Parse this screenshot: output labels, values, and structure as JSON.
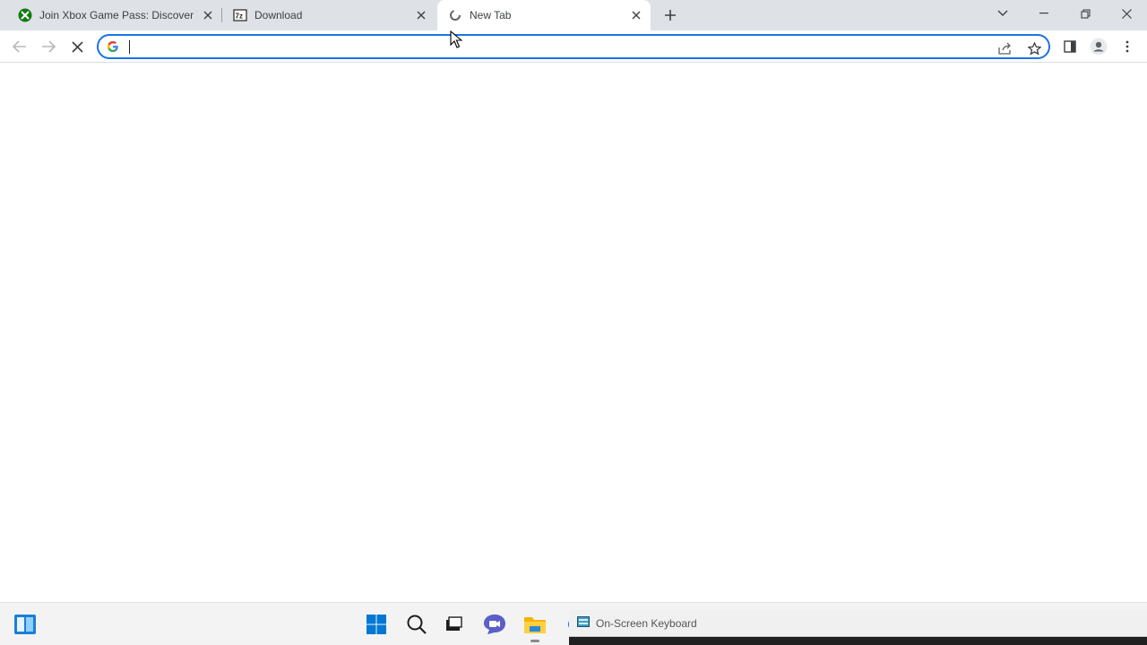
{
  "browser": {
    "tabs": [
      {
        "title": "Join Xbox Game Pass: Discover Yo",
        "icon": "xbox-icon"
      },
      {
        "title": "Download",
        "icon": "7zip-icon"
      },
      {
        "title": "New Tab",
        "icon": "loading-icon"
      }
    ],
    "omnibox": {
      "value": "",
      "placeholder": ""
    },
    "colors": {
      "accent": "#1a73e8",
      "tabstrip": "#dee1e6",
      "xbox": "#107c10"
    }
  },
  "taskbar": {
    "osk_title": "On-Screen Keyboard"
  }
}
